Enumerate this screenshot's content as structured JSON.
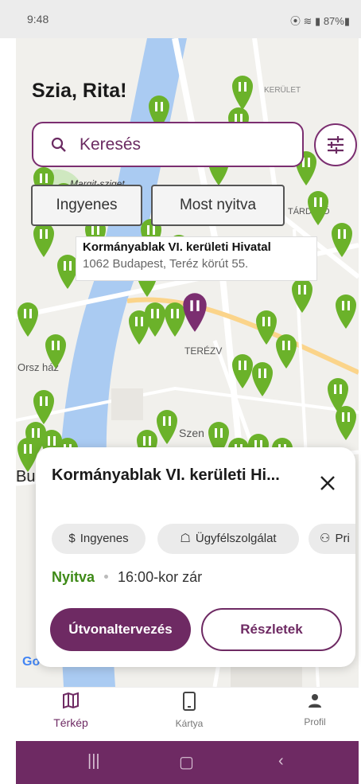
{
  "status_bar": {
    "time": "9:48",
    "right_icons": "⦿ ≋ ▮ 87%▮"
  },
  "header": {
    "greeting": "Szia, Rita!"
  },
  "search": {
    "placeholder": "Keresés"
  },
  "filters": [
    "Ingyenes",
    "Most nyitva"
  ],
  "tooltip": {
    "name": "Kormányablak VI. kerületi Hivatal",
    "address": "1062 Budapest, Teréz körút 55."
  },
  "map_labels": {
    "margit": "Margit-sziget",
    "terez": "TERÉZV",
    "orszaghaz": "Orsz    ház",
    "szen": "Szen",
    "kerulet": "KERÜLET",
    "tardulo": "TÁRDŰLŐ",
    "bu": "Bu",
    "google": "Go"
  },
  "card": {
    "title": "Kormányablak VI. kerületi Hi...",
    "tags": [
      {
        "icon": "dollar-icon",
        "label": "Ingyenes"
      },
      {
        "icon": "service-icon",
        "label": "Ügyfélszolgálat"
      },
      {
        "icon": "people-icon",
        "label": "Pri"
      }
    ],
    "status": "Nyitva",
    "closing": "16:00-kor zár",
    "route_button": "Útvonaltervezés",
    "details_button": "Részletek"
  },
  "bottom_nav": [
    {
      "icon": "map-icon",
      "label": "Térkép",
      "active": true
    },
    {
      "icon": "card-icon",
      "label": "Kártya",
      "active": false
    },
    {
      "icon": "profile-icon",
      "label": "Profil",
      "active": false
    }
  ],
  "colors": {
    "primary": "#6e2a63",
    "pin_green": "#6bb22a",
    "pin_selected": "#7b2e70",
    "open_green": "#3e8a17"
  }
}
